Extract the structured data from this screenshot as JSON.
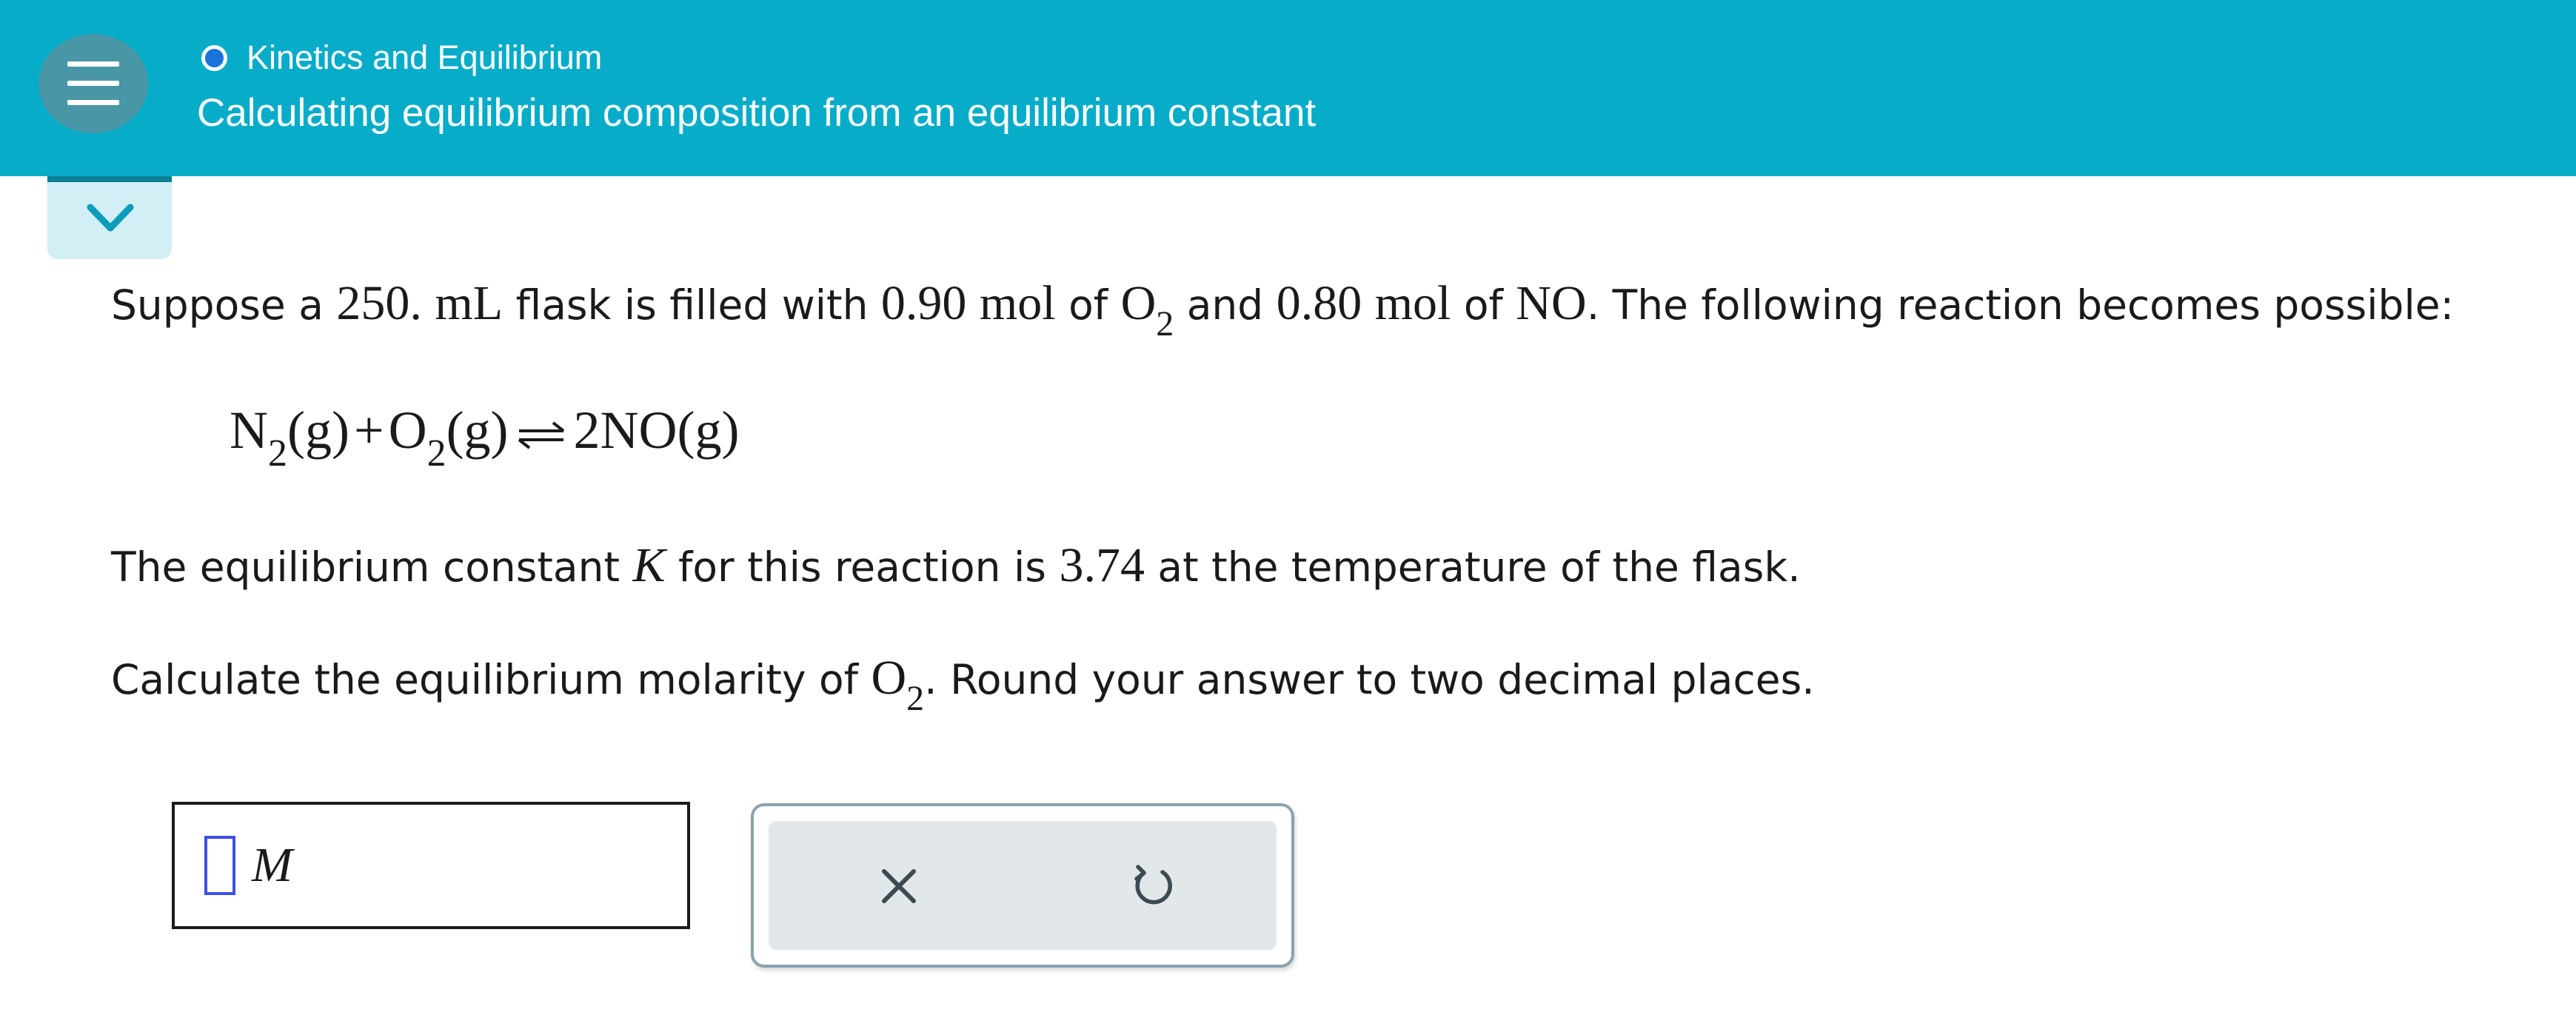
{
  "header": {
    "topic": "Kinetics and Equilibrium",
    "lesson_title": "Calculating equilibrium composition from an equilibrium constant",
    "background_color": "#07acc9"
  },
  "icons": {
    "menu": "hamburger-menu-icon",
    "topic_status": "circle-icon",
    "expand": "chevron-down-icon",
    "clear": "close-icon",
    "undo": "undo-icon"
  },
  "problem": {
    "p1_a": "Suppose a ",
    "volume": "250.",
    "volume_unit": "mL",
    "p1_b": " flask is filled with ",
    "o2_amount": "0.90",
    "mol_unit": "mol",
    "p1_c": " of ",
    "o2_formula": "O",
    "o2_sub": "2",
    "p1_d": " and ",
    "no_amount": "0.80",
    "mol_unit_2": "mol",
    "p1_e": " of ",
    "no_formula": "NO",
    "p1_f": ". The following reaction becomes possible:",
    "equation": {
      "n2": "N",
      "n2_sub": "2",
      "n2_state": "(g)",
      "plus": "+",
      "o2": "O",
      "o2_sub": "2",
      "o2_state": "(g)",
      "product": "2NO",
      "product_state": "(g)"
    },
    "p2_a": "The equilibrium constant ",
    "k_symbol": "K",
    "p2_b": " for this reaction is ",
    "k_value": "3.74",
    "p2_c": " at the temperature of the flask.",
    "p3_a": "Calculate the equilibrium molarity of ",
    "p3_formula": "O",
    "p3_sub": "2",
    "p3_b": ". Round your answer to two decimal places."
  },
  "answer": {
    "value": "",
    "unit": "M"
  }
}
